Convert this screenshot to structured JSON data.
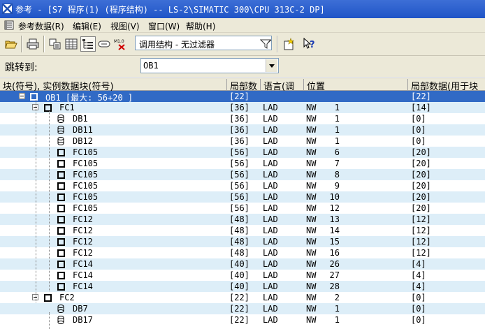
{
  "window": {
    "title": "参考 - [S7 程序(1) (程序结构) -- LS-2\\SIMATIC 300\\CPU 313C-2 DP]"
  },
  "menu": [
    {
      "label": "参考数据(R)"
    },
    {
      "label": "编辑(E)"
    },
    {
      "label": "视图(V)"
    },
    {
      "label": "窗口(W)"
    },
    {
      "label": "帮助(H)"
    }
  ],
  "toolbar": {
    "icons": [
      "open-icon",
      "print-icon",
      "cross-reference-icon",
      "assignment-icon",
      "program-structure-icon",
      "unused-symbols-icon",
      "address-without-symbol-icon",
      "filter-icon",
      "new-window-icon",
      "context-help-icon"
    ],
    "filter_value": "调用结构 - 无过滤器"
  },
  "goto": {
    "label": "跳转到:",
    "value": "OB1"
  },
  "columns": {
    "block": "块(符号), 实例数据块(符号)",
    "local": "局部数",
    "lang": "语言(调",
    "pos": "位置",
    "local_data": "局部数据(用于块"
  },
  "rows": [
    {
      "level": 0,
      "kind": "ob",
      "name": "OB1 [最大: 56+20 ]",
      "local": "[22]",
      "lang": "",
      "pos_type": "",
      "pos_num": "",
      "local_data": "[22]"
    },
    {
      "level": 1,
      "kind": "fc",
      "name": "FC1",
      "local": "[36]",
      "lang": "LAD",
      "pos_type": "NW",
      "pos_num": "1",
      "local_data": "[14]"
    },
    {
      "level": 2,
      "kind": "db",
      "name": "DB1",
      "local": "[36]",
      "lang": "LAD",
      "pos_type": "NW",
      "pos_num": "1",
      "local_data": "[0]"
    },
    {
      "level": 2,
      "kind": "db",
      "name": "DB11",
      "local": "[36]",
      "lang": "LAD",
      "pos_type": "NW",
      "pos_num": "1",
      "local_data": "[0]"
    },
    {
      "level": 2,
      "kind": "db",
      "name": "DB12",
      "local": "[36]",
      "lang": "LAD",
      "pos_type": "NW",
      "pos_num": "1",
      "local_data": "[0]"
    },
    {
      "level": 2,
      "kind": "fcl",
      "name": "FC105",
      "local": "[56]",
      "lang": "LAD",
      "pos_type": "NW",
      "pos_num": "6",
      "local_data": "[20]"
    },
    {
      "level": 2,
      "kind": "fcl",
      "name": "FC105",
      "local": "[56]",
      "lang": "LAD",
      "pos_type": "NW",
      "pos_num": "7",
      "local_data": "[20]"
    },
    {
      "level": 2,
      "kind": "fcl",
      "name": "FC105",
      "local": "[56]",
      "lang": "LAD",
      "pos_type": "NW",
      "pos_num": "8",
      "local_data": "[20]"
    },
    {
      "level": 2,
      "kind": "fcl",
      "name": "FC105",
      "local": "[56]",
      "lang": "LAD",
      "pos_type": "NW",
      "pos_num": "9",
      "local_data": "[20]"
    },
    {
      "level": 2,
      "kind": "fcl",
      "name": "FC105",
      "local": "[56]",
      "lang": "LAD",
      "pos_type": "NW",
      "pos_num": "10",
      "local_data": "[20]"
    },
    {
      "level": 2,
      "kind": "fcl",
      "name": "FC105",
      "local": "[56]",
      "lang": "LAD",
      "pos_type": "NW",
      "pos_num": "12",
      "local_data": "[20]"
    },
    {
      "level": 2,
      "kind": "fcl",
      "name": "FC12",
      "local": "[48]",
      "lang": "LAD",
      "pos_type": "NW",
      "pos_num": "13",
      "local_data": "[12]"
    },
    {
      "level": 2,
      "kind": "fcl",
      "name": "FC12",
      "local": "[48]",
      "lang": "LAD",
      "pos_type": "NW",
      "pos_num": "14",
      "local_data": "[12]"
    },
    {
      "level": 2,
      "kind": "fcl",
      "name": "FC12",
      "local": "[48]",
      "lang": "LAD",
      "pos_type": "NW",
      "pos_num": "15",
      "local_data": "[12]"
    },
    {
      "level": 2,
      "kind": "fcl",
      "name": "FC12",
      "local": "[48]",
      "lang": "LAD",
      "pos_type": "NW",
      "pos_num": "16",
      "local_data": "[12]"
    },
    {
      "level": 2,
      "kind": "fcl",
      "name": "FC14",
      "local": "[40]",
      "lang": "LAD",
      "pos_type": "NW",
      "pos_num": "26",
      "local_data": "[4]"
    },
    {
      "level": 2,
      "kind": "fcl",
      "name": "FC14",
      "local": "[40]",
      "lang": "LAD",
      "pos_type": "NW",
      "pos_num": "27",
      "local_data": "[4]"
    },
    {
      "level": 2,
      "kind": "fcl",
      "name": "FC14",
      "local": "[40]",
      "lang": "LAD",
      "pos_type": "NW",
      "pos_num": "28",
      "local_data": "[4]"
    },
    {
      "level": 1,
      "kind": "fc",
      "name": "FC2",
      "local": "[22]",
      "lang": "LAD",
      "pos_type": "NW",
      "pos_num": "2",
      "local_data": "[0]"
    },
    {
      "level": 2,
      "kind": "db",
      "name": "DB7",
      "local": "[22]",
      "lang": "LAD",
      "pos_type": "NW",
      "pos_num": "1",
      "local_data": "[0]"
    },
    {
      "level": 2,
      "kind": "db",
      "name": "DB17",
      "local": "[22]",
      "lang": "LAD",
      "pos_type": "NW",
      "pos_num": "1",
      "local_data": "[0]"
    }
  ]
}
